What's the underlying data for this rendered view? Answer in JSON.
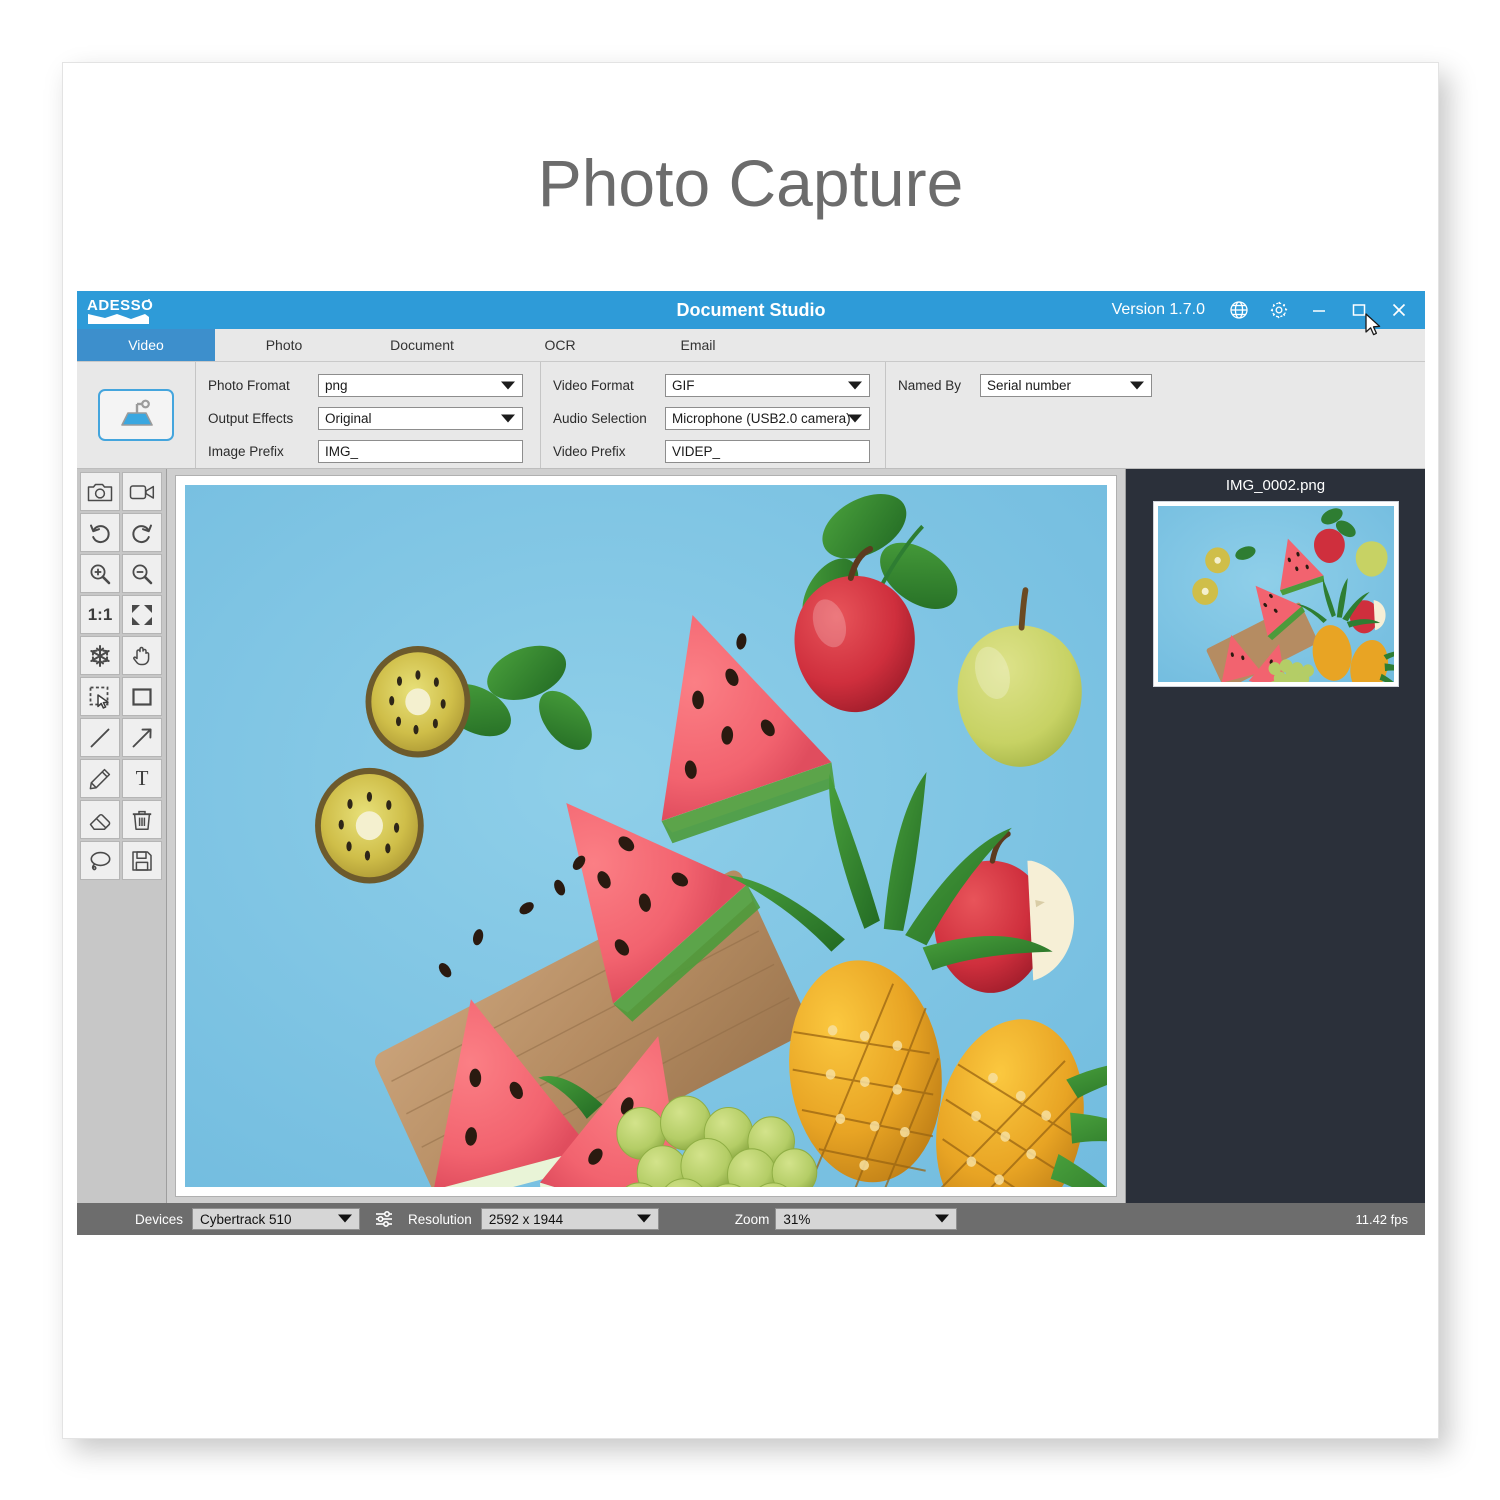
{
  "page": {
    "title": "Photo Capture"
  },
  "window": {
    "logo_alt": "ADESSO",
    "title": "Document Studio",
    "version": "Version 1.7.0",
    "buttons": {
      "language": "globe-icon",
      "settings": "gear-icon",
      "minimize": "minimize-icon",
      "maximize": "maximize-icon",
      "close": "close-icon"
    }
  },
  "tabs": [
    {
      "label": "Video",
      "active": true
    },
    {
      "label": "Photo",
      "active": false
    },
    {
      "label": "Document",
      "active": false
    },
    {
      "label": "OCR",
      "active": false
    },
    {
      "label": "Email",
      "active": false
    }
  ],
  "settings": {
    "scan_button_icon": "document-camera-icon",
    "col1": [
      {
        "label": "Photo Fromat",
        "value": "png",
        "type": "select"
      },
      {
        "label": "Output Effects",
        "value": "Original",
        "type": "select"
      },
      {
        "label": "Image Prefix",
        "value": "IMG_",
        "type": "text"
      }
    ],
    "col2": [
      {
        "label": "Video Format",
        "value": "GIF",
        "type": "select"
      },
      {
        "label": "Audio Selection",
        "value": "Microphone (USB2.0 camera)",
        "type": "select"
      },
      {
        "label": "Video Prefix",
        "value": "VIDEP_",
        "type": "text"
      }
    ],
    "col3": [
      {
        "label": "Named By",
        "value": "Serial number",
        "type": "select"
      }
    ]
  },
  "toolbar": [
    {
      "name": "capture-photo",
      "icon": "camera-icon"
    },
    {
      "name": "capture-video",
      "icon": "video-camera-icon"
    },
    {
      "name": "undo",
      "icon": "undo-icon"
    },
    {
      "name": "redo",
      "icon": "redo-icon"
    },
    {
      "name": "zoom-in",
      "icon": "zoom-in-icon"
    },
    {
      "name": "zoom-out",
      "icon": "zoom-out-icon"
    },
    {
      "name": "actual-size",
      "icon": "one-to-one-icon",
      "text": "1:1"
    },
    {
      "name": "fit-to-screen",
      "icon": "fit-screen-icon"
    },
    {
      "name": "freeze",
      "icon": "snowflake-icon"
    },
    {
      "name": "pan",
      "icon": "hand-icon"
    },
    {
      "name": "select-region",
      "icon": "marquee-select-icon"
    },
    {
      "name": "draw-rectangle",
      "icon": "rectangle-icon"
    },
    {
      "name": "draw-line",
      "icon": "line-icon"
    },
    {
      "name": "draw-arrow",
      "icon": "arrow-icon"
    },
    {
      "name": "pencil",
      "icon": "pencil-icon"
    },
    {
      "name": "add-text",
      "icon": "text-icon",
      "text": "T"
    },
    {
      "name": "eraser",
      "icon": "eraser-icon"
    },
    {
      "name": "delete",
      "icon": "trash-icon"
    },
    {
      "name": "lasso",
      "icon": "lasso-icon"
    },
    {
      "name": "save",
      "icon": "save-floppy-icon"
    }
  ],
  "thumbnail": {
    "filename": "IMG_0002.png"
  },
  "statusbar": {
    "devices_label": "Devices",
    "devices_value": "Cybertrack 510",
    "device_settings_icon": "sliders-icon",
    "resolution_label": "Resolution",
    "resolution_value": "2592 x 1944",
    "zoom_label": "Zoom",
    "zoom_value": "31%",
    "fps": "11.42 fps"
  },
  "colors": {
    "titlebar": "#2e9bd8",
    "active_tab": "#3d8fcc",
    "thumb_panel": "#2b303a",
    "statusbar": "#6d6d6d",
    "accent": "#44a5dd",
    "photo_background": "#7cc2e3"
  }
}
